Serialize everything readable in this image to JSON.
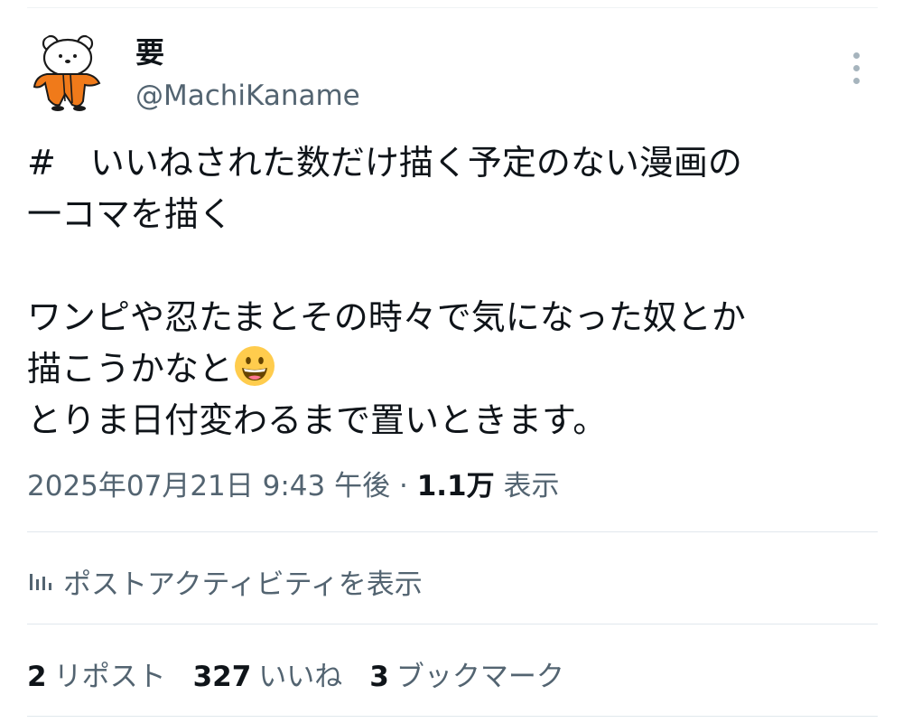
{
  "post": {
    "author": {
      "display_name": "要",
      "handle": "@MachiKaname",
      "avatar_icon": "bear-character-avatar"
    },
    "more_icon": "more-vertical-icon",
    "text_lines": [
      "#　いいねされた数だけ描く予定のない漫画の",
      "一コマを描く",
      "",
      "ワンピや忍たまとその時々で気になった奴とか",
      "描こうかなと",
      "とりま日付変わるまで置いときます。"
    ],
    "emoji": "grinning-face-emoji",
    "timestamp": "2025年07月21日 9:43 午後",
    "separator": "·",
    "views_count": "1.1万",
    "views_label": "表示"
  },
  "activity": {
    "icon": "analytics-bars-icon",
    "label": "ポストアクティビティを表示"
  },
  "stats": {
    "reposts": {
      "count": "2",
      "label": "リポスト"
    },
    "likes": {
      "count": "327",
      "label": "いいね"
    },
    "bookmarks": {
      "count": "3",
      "label": "ブックマーク"
    }
  },
  "colors": {
    "text_primary": "#0f1419",
    "text_secondary": "#536471",
    "divider": "#e1e8ed",
    "avatar_orange": "#f07a1a"
  }
}
